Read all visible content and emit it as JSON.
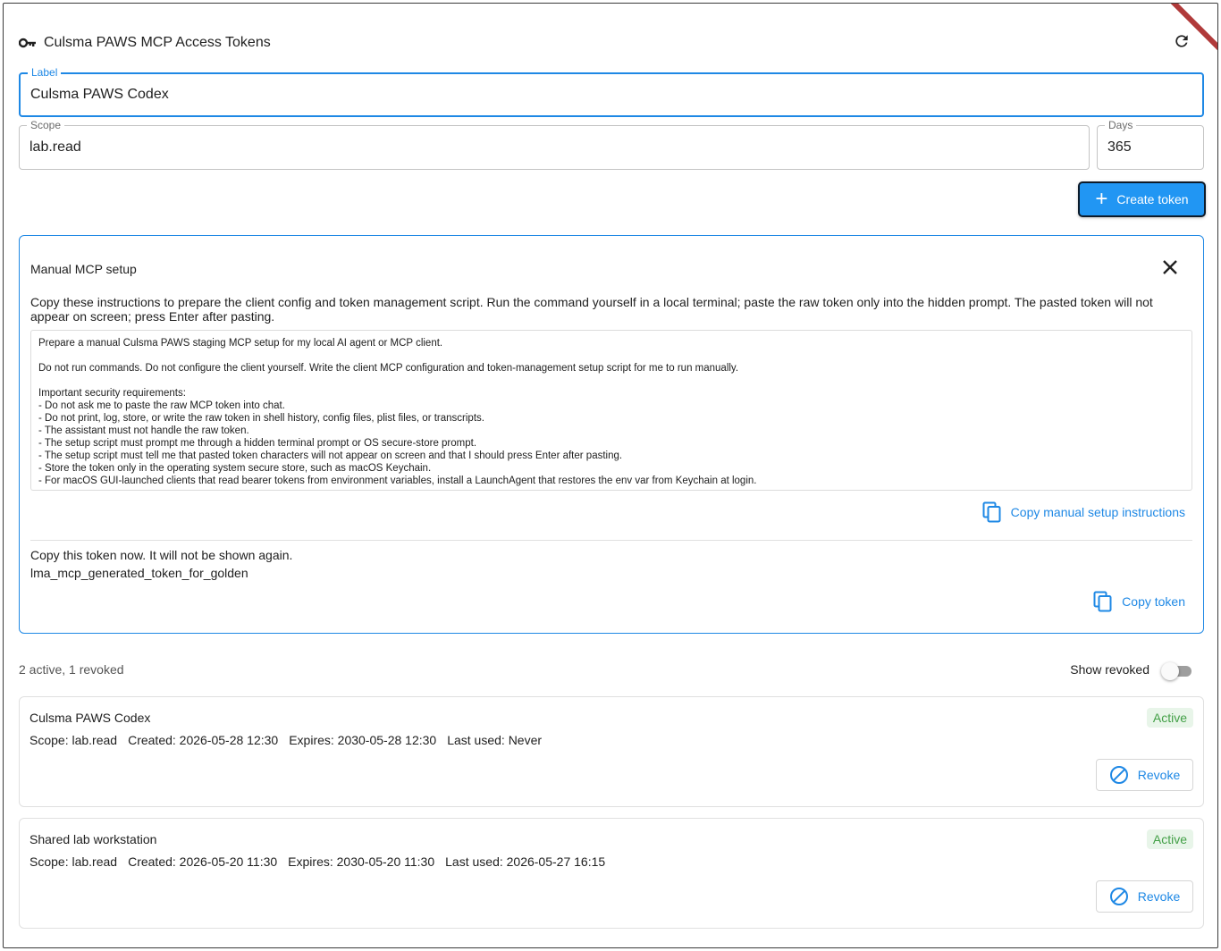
{
  "header": {
    "title": "Culsma PAWS MCP Access Tokens",
    "icon": "key-icon",
    "refresh_icon": "refresh-icon"
  },
  "form": {
    "label_field": {
      "label": "Label",
      "value": "Culsma PAWS Codex"
    },
    "scope_field": {
      "label": "Scope",
      "value": "lab.read"
    },
    "days_field": {
      "label": "Days",
      "value": "365"
    },
    "create_button": "Create token"
  },
  "setup_panel": {
    "title": "Manual MCP setup",
    "description": "Copy these instructions to prepare the client config and token management script. Run the command yourself in a local terminal; paste the raw token only into the hidden prompt. The pasted token will not appear on screen; press Enter after pasting.",
    "instructions": "Prepare a manual Culsma PAWS staging MCP setup for my local AI agent or MCP client.\n\nDo not run commands. Do not configure the client yourself. Write the client MCP configuration and token-management setup script for me to run manually.\n\nImportant security requirements:\n- Do not ask me to paste the raw MCP token into chat.\n- Do not print, log, store, or write the raw token in shell history, config files, plist files, or transcripts.\n- The assistant must not handle the raw token.\n- The setup script must prompt me through a hidden terminal prompt or OS secure-store prompt.\n- The setup script must tell me that pasted token characters will not appear on screen and that I should press Enter after pasting.\n- Store the token only in the operating system secure store, such as macOS Keychain.\n- For macOS GUI-launched clients that read bearer tokens from environment variables, install a LaunchAgent that restores the env var from Keychain at login.",
    "copy_instructions_button": "Copy manual setup instructions",
    "token_note": "Copy this token now. It will not be shown again.",
    "token_value": "lma_mcp_generated_token_for_golden",
    "copy_token_button": "Copy token"
  },
  "list": {
    "summary": "2 active, 1 revoked",
    "show_revoked_label": "Show revoked",
    "show_revoked_on": false
  },
  "tokens": [
    {
      "name": "Culsma PAWS Codex",
      "scope": "Scope: lab.read",
      "created": "Created: 2026-05-28 12:30",
      "expires": "Expires: 2030-05-28 12:30",
      "last_used": "Last used: Never",
      "status": "Active",
      "revoke_label": "Revoke"
    },
    {
      "name": "Shared lab workstation",
      "scope": "Scope: lab.read",
      "created": "Created: 2026-05-20 11:30",
      "expires": "Expires: 2030-05-20 11:30",
      "last_used": "Last used: 2026-05-27 16:15",
      "status": "Active",
      "revoke_label": "Revoke"
    }
  ],
  "colors": {
    "accent": "#1e88e5",
    "primary_button": "#2196f3",
    "active_badge_bg": "#e8f5e9",
    "active_badge_text": "#43a047"
  }
}
